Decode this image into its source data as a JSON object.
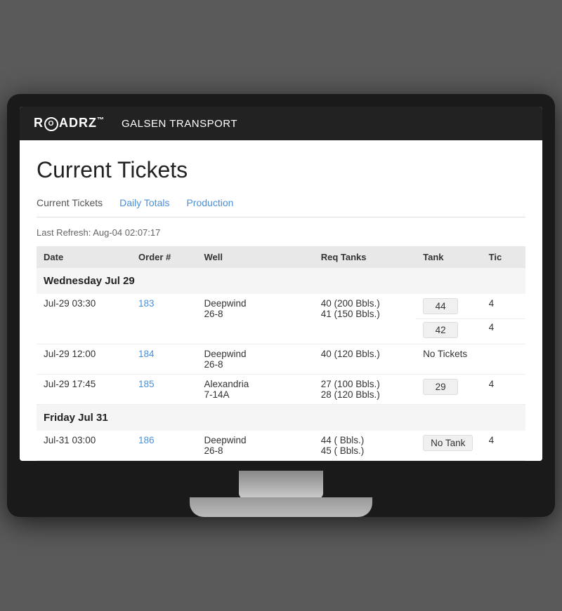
{
  "header": {
    "logo_text": "ROADRZ",
    "company": "GALSEN TRANSPORT"
  },
  "page": {
    "title": "Current Tickets",
    "last_refresh": "Last Refresh: Aug-04 02:07:17"
  },
  "tabs": [
    {
      "label": "Current Tickets",
      "active": true
    },
    {
      "label": "Daily Totals",
      "active": false
    },
    {
      "label": "Production",
      "active": false
    }
  ],
  "table": {
    "columns": [
      "Date",
      "Order #",
      "Well",
      "Req Tanks",
      "Tank",
      "Tic"
    ],
    "groups": [
      {
        "header": "Wednesday Jul 29",
        "rows": [
          {
            "date": "Jul-29 03:30",
            "order": "183",
            "well": "Deepwind 26-8",
            "req_tanks": [
              "40 (200 Bbls.)",
              "41 (150 Bbls.)"
            ],
            "tanks": [
              {
                "id": "44",
                "ticket": "4"
              },
              {
                "id": "42",
                "ticket": "4"
              }
            ],
            "no_tickets": false
          },
          {
            "date": "Jul-29 12:00",
            "order": "184",
            "well": "Deepwind 26-8",
            "req_tanks": [
              "40 (120 Bbls.)"
            ],
            "tanks": [],
            "no_tickets": true
          },
          {
            "date": "Jul-29 17:45",
            "order": "185",
            "well": "Alexandria 7-14A",
            "req_tanks": [
              "27 (100 Bbls.)",
              "28 (120 Bbls.)"
            ],
            "tanks": [
              {
                "id": "29",
                "ticket": "4"
              }
            ],
            "no_tickets": false
          }
        ]
      },
      {
        "header": "Friday Jul 31",
        "rows": [
          {
            "date": "Jul-31 03:00",
            "order": "186",
            "well": "Deepwind 26-8",
            "req_tanks": [
              "44 ( Bbls.)",
              "45 ( Bbls.)"
            ],
            "tanks": [],
            "no_tank": true,
            "no_tickets": false,
            "ticket_val": "4"
          }
        ]
      }
    ]
  }
}
